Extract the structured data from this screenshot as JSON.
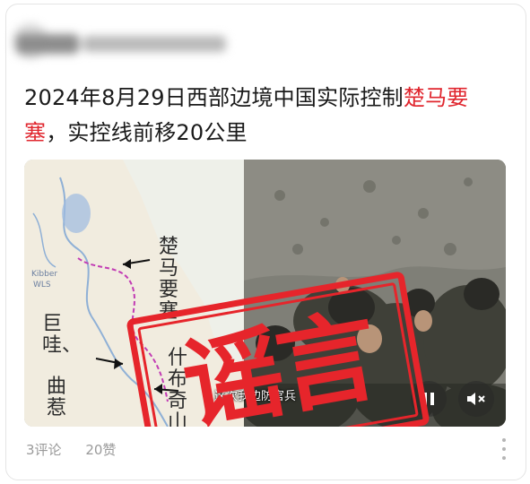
{
  "post": {
    "title_main": "2024年8月29日西部边境中国实际控制",
    "title_highlight": "楚马要",
    "title_highlight2": "塞",
    "title_tail": "，实控线前移20公里"
  },
  "media": {
    "map_labels": {
      "label_1": "楚马要塞",
      "label_2": "巨哇、",
      "label_3": "曲惹",
      "label_4": "什布奇山",
      "small_1": "Kibber",
      "small_2": "WLS"
    },
    "video_caption": "这次我边防官兵",
    "stamp_text": "谣言"
  },
  "footer": {
    "comments": "3评论",
    "likes": "20赞"
  },
  "colors": {
    "highlight": "#e0262e",
    "stamp": "#e6252b"
  },
  "icons": {
    "pause": "pause-icon",
    "mute": "mute-icon",
    "more": "more-vertical-icon"
  }
}
